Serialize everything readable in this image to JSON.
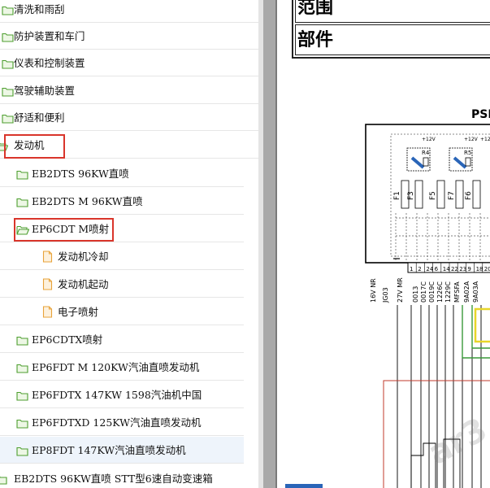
{
  "tree": {
    "items": [
      {
        "label": "清洗和雨刮",
        "icon": "folder-icon"
      },
      {
        "label": "防护装置和车门",
        "icon": "folder-icon"
      },
      {
        "label": "仪表和控制装置",
        "icon": "folder-icon"
      },
      {
        "label": "驾驶辅助装置",
        "icon": "folder-icon"
      },
      {
        "label": "舒适和便利",
        "icon": "folder-icon"
      },
      {
        "label": "发动机",
        "icon": "folder-open-icon"
      },
      {
        "label": "EB2DTS 96KW直喷",
        "icon": "folder-icon"
      },
      {
        "label": "EB2DTS M 96KW直喷",
        "icon": "folder-icon"
      },
      {
        "label": "EP6CDT M喷射",
        "icon": "folder-open-icon"
      },
      {
        "label": "发动机冷却",
        "icon": "document-icon"
      },
      {
        "label": "发动机起动",
        "icon": "document-icon"
      },
      {
        "label": "电子喷射",
        "icon": "document-icon"
      },
      {
        "label": "EP6CDTX喷射",
        "icon": "folder-icon"
      },
      {
        "label": "EP6FDT M 120KW汽油直喷发动机",
        "icon": "folder-icon"
      },
      {
        "label": "EP6FDTX 147KW 1598汽油机中国",
        "icon": "folder-icon"
      },
      {
        "label": "EP6FDTXD 125KW汽油直喷发动机",
        "icon": "folder-icon"
      },
      {
        "label": "EP8FDT 147KW汽油直喷发动机",
        "icon": "folder-icon"
      },
      {
        "label": "EB2DTS 96KW直喷 STT型6速自动变速箱",
        "icon": "folder-icon"
      }
    ]
  },
  "document": {
    "header_row1": "范围",
    "header_row2": "部件",
    "diagram": {
      "title_fragment": "PSF",
      "supply_labels": [
        "+12V",
        "+12V",
        "+12V"
      ],
      "relay_labels": [
        "R4",
        "R5"
      ],
      "fuse_labels": [
        "F1",
        "F3",
        "F5",
        "F7",
        "F6"
      ],
      "pin_numbers": [
        "1",
        "2",
        "24",
        "6",
        "14",
        "22",
        "23",
        "9",
        "18",
        "20"
      ],
      "wire_labels": [
        "16V NR",
        "JG03",
        "27V MR",
        "0013",
        "0017C",
        "0019C",
        "1226C",
        "1229C",
        "MFSFA",
        "9A02A",
        "9A03A"
      ],
      "watermark": "ar3"
    },
    "colors": {
      "accent_green": "#3a9a3a",
      "highlight_yellow": "#e8d62a",
      "wire_red": "#c0392b",
      "relay_blue": "#2a65b8"
    }
  },
  "colors": {
    "selection_border": "#d9352b",
    "folder_stroke": "#4d9e2f",
    "folder_fill": "#edf7e5",
    "doc_icon": "#e8a33a"
  }
}
